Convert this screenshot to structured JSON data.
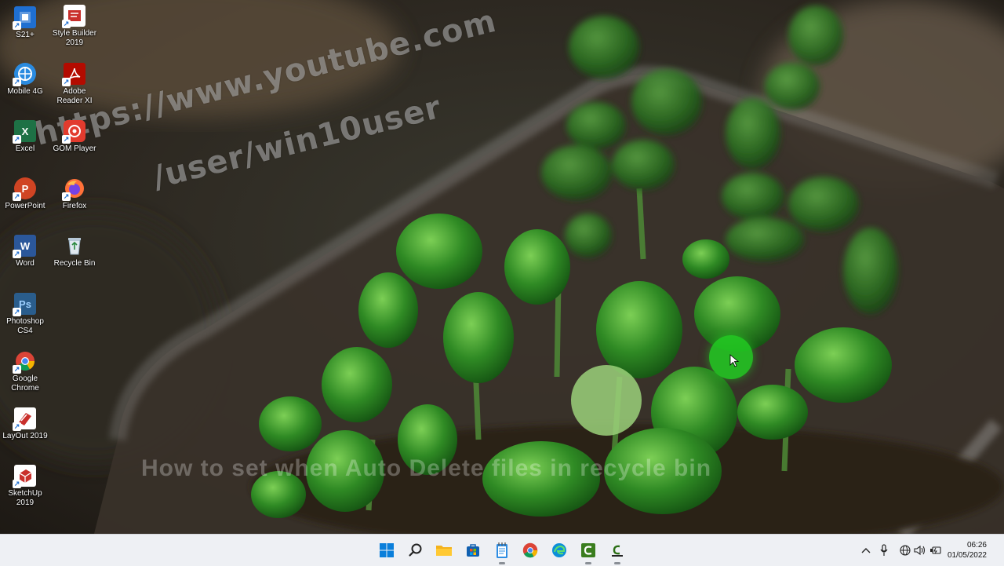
{
  "desktop": {
    "icons_left": [
      {
        "label": "S21+",
        "icon": "s21-shortcut-icon",
        "color": "#1f6fd1"
      },
      {
        "label": "Mobile 4G",
        "icon": "mobile-4g-icon",
        "color": "#2a8be0"
      },
      {
        "label": "Excel",
        "icon": "excel-icon",
        "color": "#1e7145"
      },
      {
        "label": "PowerPoint",
        "icon": "powerpoint-icon",
        "color": "#d04423"
      },
      {
        "label": "Word",
        "icon": "word-icon",
        "color": "#2b579a"
      },
      {
        "label": "Photoshop CS4",
        "icon": "photoshop-icon",
        "color": "#2a5d8c"
      },
      {
        "label": "Google Chrome",
        "icon": "chrome-icon",
        "color": "#db4437"
      },
      {
        "label": "LayOut 2019",
        "icon": "layout-icon",
        "color": "#c9302c"
      },
      {
        "label": "SketchUp 2019",
        "icon": "sketchup-icon",
        "color": "#c9302c"
      }
    ],
    "icons_right": [
      {
        "label": "Style Builder 2019",
        "icon": "style-builder-icon",
        "color": "#c9302c"
      },
      {
        "label": "Adobe Reader XI",
        "icon": "adobe-reader-icon",
        "color": "#b30b00"
      },
      {
        "label": "GOM Player",
        "icon": "gom-player-icon",
        "color": "#e23b2e"
      },
      {
        "label": "Firefox",
        "icon": "firefox-icon",
        "color": "#ff7139"
      },
      {
        "label": "Recycle Bin",
        "icon": "recycle-bin-icon",
        "color": "#9fb7c9"
      }
    ]
  },
  "watermark": {
    "line1": "https://www.youtube.com",
    "line2": "/user/win10user",
    "caption": "How to set when Auto Delete files in recycle bin"
  },
  "taskbar": {
    "apps": [
      {
        "name": "start-button",
        "icon": "windows-logo-icon"
      },
      {
        "name": "search-button",
        "icon": "search-icon"
      },
      {
        "name": "file-explorer-button",
        "icon": "folder-icon"
      },
      {
        "name": "microsoft-store-button",
        "icon": "store-icon"
      },
      {
        "name": "notepad-button",
        "icon": "notepad-icon"
      },
      {
        "name": "chrome-taskbar-button",
        "icon": "chrome-icon"
      },
      {
        "name": "edge-taskbar-button",
        "icon": "edge-icon"
      },
      {
        "name": "camtasia-button",
        "icon": "camtasia-icon"
      },
      {
        "name": "camtasia-recorder-button",
        "icon": "camtasia-recorder-icon"
      }
    ],
    "tray": {
      "time": "06:26",
      "date": "01/05/2022"
    }
  },
  "colors": {
    "taskbar_bg": "#eef0f4",
    "cursor_highlight": "#22cc22"
  }
}
